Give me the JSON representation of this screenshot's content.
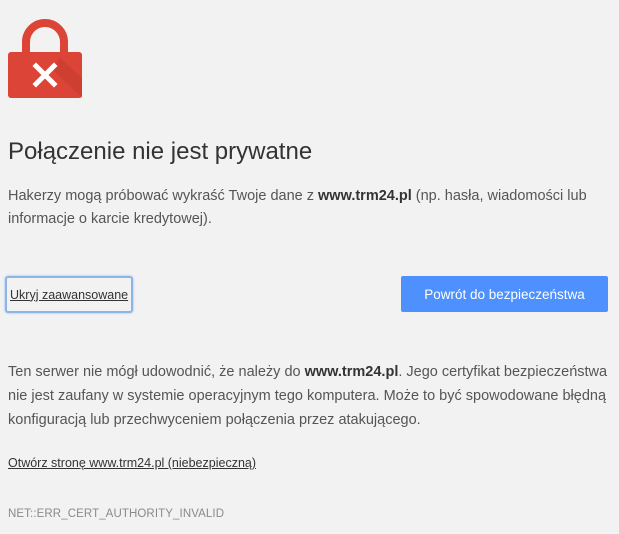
{
  "icon": "lock-error-icon",
  "colors": {
    "lock_red": "#db4437",
    "lock_dark_red": "#c33c2f",
    "button_blue": "#4d90fe",
    "background": "#f2f2f2"
  },
  "heading": "Połączenie nie jest prywatne",
  "message": {
    "before": "Hakerzy mogą próbować wykraść Twoje dane z ",
    "domain": "www.trm24.pl",
    "after": " (np. hasła, wiadomości lub informacje o karcie kredytowej)."
  },
  "buttons": {
    "advanced": "Ukryj zaawansowane",
    "back": "Powrót do bezpieczeństwa"
  },
  "details": {
    "before": "Ten serwer nie mógł udowodnić, że należy do ",
    "domain": "www.trm24.pl",
    "after": ". Jego certyfikat bezpieczeństwa nie jest zaufany w systemie operacyjnym tego komputera. Może to być spowodowane błędną konfiguracją lub przechwyceniem połączenia przez atakującego."
  },
  "proceed_link": "Otwórz stronę www.trm24.pl (niebezpieczną)",
  "error_code": "NET::ERR_CERT_AUTHORITY_INVALID"
}
